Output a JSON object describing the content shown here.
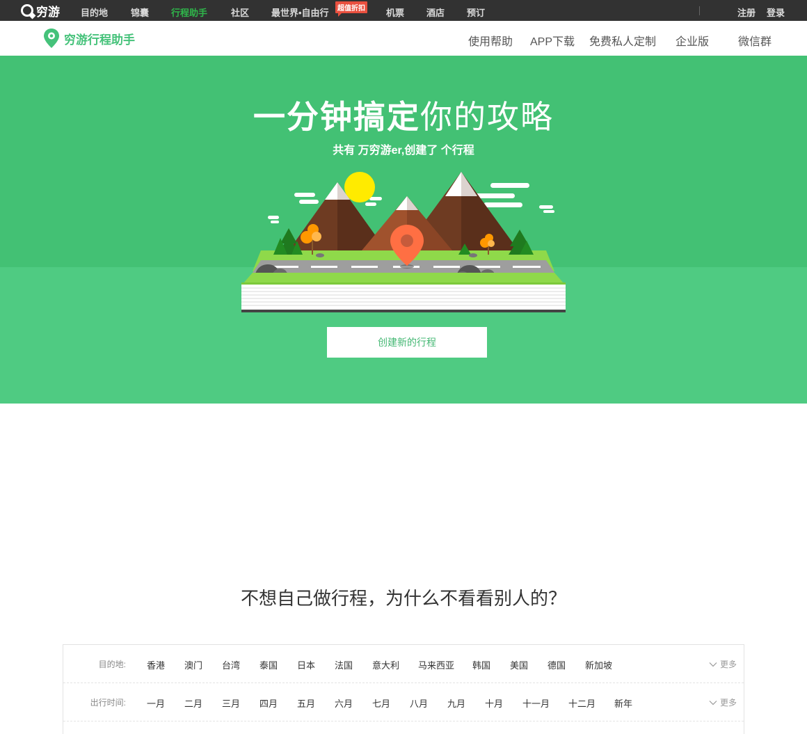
{
  "topbar": {
    "logo_text": "穷游",
    "nav": [
      {
        "label": "目的地",
        "active": false
      },
      {
        "label": "锦囊",
        "active": false
      },
      {
        "label": "行程助手",
        "active": true
      },
      {
        "label": "社区",
        "active": false
      },
      {
        "label": "最世界•自由行",
        "active": false
      },
      {
        "label": "机票",
        "active": false
      },
      {
        "label": "酒店",
        "active": false
      },
      {
        "label": "预订",
        "active": false
      }
    ],
    "hot_badge": "超值折扣",
    "register": "注册",
    "login": "登录"
  },
  "subheader": {
    "brand": "穷游行程助手",
    "nav": [
      "使用帮助",
      "APP下载",
      "免费私人定制",
      "企业版",
      "微信群"
    ]
  },
  "hero": {
    "title_bold": "一分钟搞定",
    "title_light": "你的攻略",
    "stat": "共有 万穷游er,创建了 个行程",
    "create_button": "创建新的行程"
  },
  "section": {
    "title": "不想自己做行程，为什么不看看别人的？"
  },
  "filters": {
    "destination": {
      "label": "目的地:",
      "options": [
        "香港",
        "澳门",
        "台湾",
        "泰国",
        "日本",
        "法国",
        "意大利",
        "马来西亚",
        "韩国",
        "美国",
        "德国",
        "新加坡"
      ],
      "more": "更多"
    },
    "time": {
      "label": "出行时间:",
      "options": [
        "一月",
        "二月",
        "三月",
        "四月",
        "五月",
        "六月",
        "七月",
        "八月",
        "九月",
        "十月",
        "十一月",
        "十二月",
        "新年"
      ],
      "more": "更多"
    }
  },
  "colors": {
    "topbar_bg": "#323232",
    "accent_green": "#2fb64b",
    "brand_green": "#45c27a",
    "hero_green": "#43c174",
    "hero_green_light": "#4fcb82",
    "badge_red": "#e9503f"
  },
  "icons": {
    "logo": "qyer-logo-icon",
    "brand": "location-pin-icon",
    "more": "chevron-down-icon"
  }
}
